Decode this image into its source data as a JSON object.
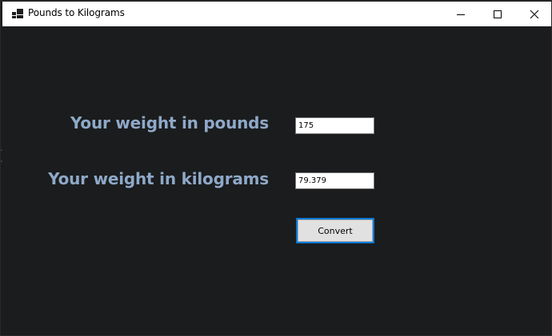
{
  "window": {
    "title": "Pounds to Kilograms",
    "icon": "app-window-icon",
    "controls": {
      "minimize": "minimize-icon",
      "maximize": "maximize-icon",
      "close": "close-icon"
    }
  },
  "form": {
    "pounds_label": "Your weight in pounds",
    "pounds_value": "175",
    "kilograms_label": "Your weight in kilograms",
    "kilograms_value": "79.379",
    "convert_label": "Convert"
  },
  "colors": {
    "background": "#1a1c1d",
    "label_text": "#8fa8c8",
    "button_focus_border": "#0078d7"
  }
}
